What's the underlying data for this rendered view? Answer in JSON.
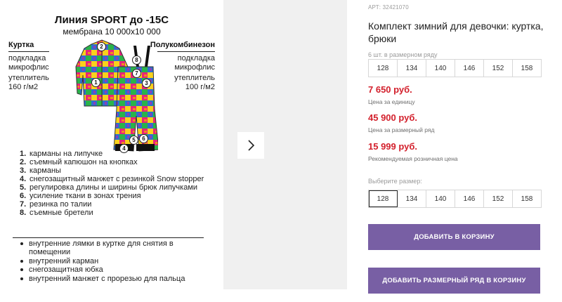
{
  "card": {
    "title": "Линия SPORT до -15С",
    "subtitle": "мембрана 10 000x10 000",
    "jacket": {
      "heading": "Куртка",
      "lining": "подкладка\nмикрофлис",
      "insulation": "утеплитель\n160 г/м2"
    },
    "overalls": {
      "heading": "Полукомбинезон",
      "lining": "подкладка\nмикрофлис",
      "insulation": "утеплитель\n100 г/м2"
    },
    "badges": [
      "1",
      "2",
      "3",
      "4",
      "5",
      "6",
      "7",
      "8"
    ],
    "features": [
      {
        "num": "1.",
        "text": "карманы на липучке"
      },
      {
        "num": "2.",
        "text": "съемный капюшон на кнопках"
      },
      {
        "num": "3.",
        "text": "карманы"
      },
      {
        "num": "4.",
        "text": "снегозащитный манжет с резинкой Snow stopper"
      },
      {
        "num": "5.",
        "text": "регулировка длины и ширины брюк липучками"
      },
      {
        "num": "6.",
        "text": "усиление ткани в зонах трения"
      },
      {
        "num": "7.",
        "text": "резинка по талии"
      },
      {
        "num": "8.",
        "text": "съемные бретели"
      }
    ],
    "extras": [
      "внутренние лямки в куртке для снятия в помещении",
      "внутренний карман",
      "снегозащитная юбка",
      "внутренний манжет с прорезью для пальца"
    ]
  },
  "gallery": {
    "next_icon": "chevron-right-icon"
  },
  "product": {
    "sku": "АРТ: 32421070",
    "title": "Комплект зимний для девочки: куртка, брюки",
    "pack_caption": "6 шт. в размерном ряду",
    "pack_sizes": [
      "128",
      "134",
      "140",
      "146",
      "152",
      "158"
    ],
    "unit_price": "7 650 руб.",
    "unit_price_caption": "Цена за единицу",
    "pack_price": "45 900 руб.",
    "pack_price_caption": "Цена за размерный ряд",
    "retail_price": "15 999 руб.",
    "retail_price_caption": "Рекомендуемая розничная цена",
    "choose_caption": "Выберите размер:",
    "sizes": [
      "128",
      "134",
      "140",
      "146",
      "152",
      "158"
    ],
    "selected_size": "128",
    "add_to_cart": "ДОБАВИТЬ В КОРЗИНУ",
    "add_pack_to_cart": "ДОБАВИТЬ РАЗМЕРНЫЙ РЯД В КОРЗИНУ"
  },
  "colors": {
    "accent": "#785fa4",
    "price": "#d3202c"
  }
}
